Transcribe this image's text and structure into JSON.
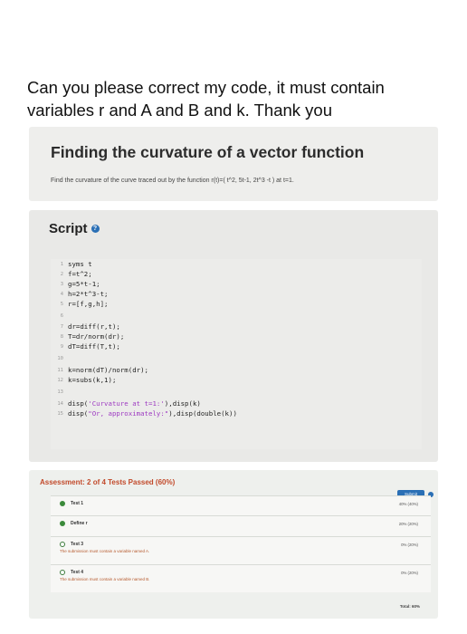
{
  "question": "Can you please correct my code, it must contain variables r and A and B and k. Thank you",
  "problem": {
    "title": "Finding the curvature of a vector function",
    "description": "Find the curvature of the curve traced out by the function r(t)=( t^2,  5t-1,  2t^3 -t ) at t=1."
  },
  "script": {
    "header": "Script",
    "help_icon": "question-circle-icon",
    "lines": [
      {
        "n": "1",
        "code": "syms t"
      },
      {
        "n": "2",
        "code": "f=t^2;"
      },
      {
        "n": "3",
        "code": "g=5*t-1;"
      },
      {
        "n": "4",
        "code": "h=2*t^3-t;"
      },
      {
        "n": "5",
        "code": "r=[f,g,h];"
      },
      {
        "n": "6",
        "code": ""
      },
      {
        "n": "7",
        "code": "dr=diff(r,t);"
      },
      {
        "n": "8",
        "code": "T=dr/norm(dr);"
      },
      {
        "n": "9",
        "code": "dT=diff(T,t);"
      },
      {
        "n": "10",
        "code": ""
      },
      {
        "n": "11",
        "code": "k=norm(dT)/norm(dr);"
      },
      {
        "n": "12",
        "code": "k=subs(k,1);"
      },
      {
        "n": "13",
        "code": ""
      },
      {
        "n": "14",
        "code_pre": "disp(",
        "code_str": "'Curvature at t=1:'",
        "code_post": "),disp(k)"
      },
      {
        "n": "15",
        "code_pre": "disp(",
        "code_str": "\"Or, approximately:\"",
        "code_post": "),disp(double(k))"
      }
    ]
  },
  "assessment": {
    "header": "Assessment: 2 of 4 Tests Passed (60%)",
    "submit_label": "Submit",
    "tests": [
      {
        "name": "Test 1",
        "status": "pass",
        "message": "",
        "score": "40% (40%)"
      },
      {
        "name": "Define r",
        "status": "pass",
        "message": "",
        "score": "20% (20%)"
      },
      {
        "name": "Test 3",
        "status": "fail",
        "message": "The submission must contain a variable named A.",
        "score": "0% (20%)"
      },
      {
        "name": "Test 4",
        "status": "fail",
        "message": "The submission must contain a variable named B.",
        "score": "0% (20%)"
      }
    ],
    "total": "Total: 60%",
    "colors": {
      "pass": "#3a8a3a",
      "header": "#c24a2b",
      "submit": "#2a6fb5"
    }
  }
}
